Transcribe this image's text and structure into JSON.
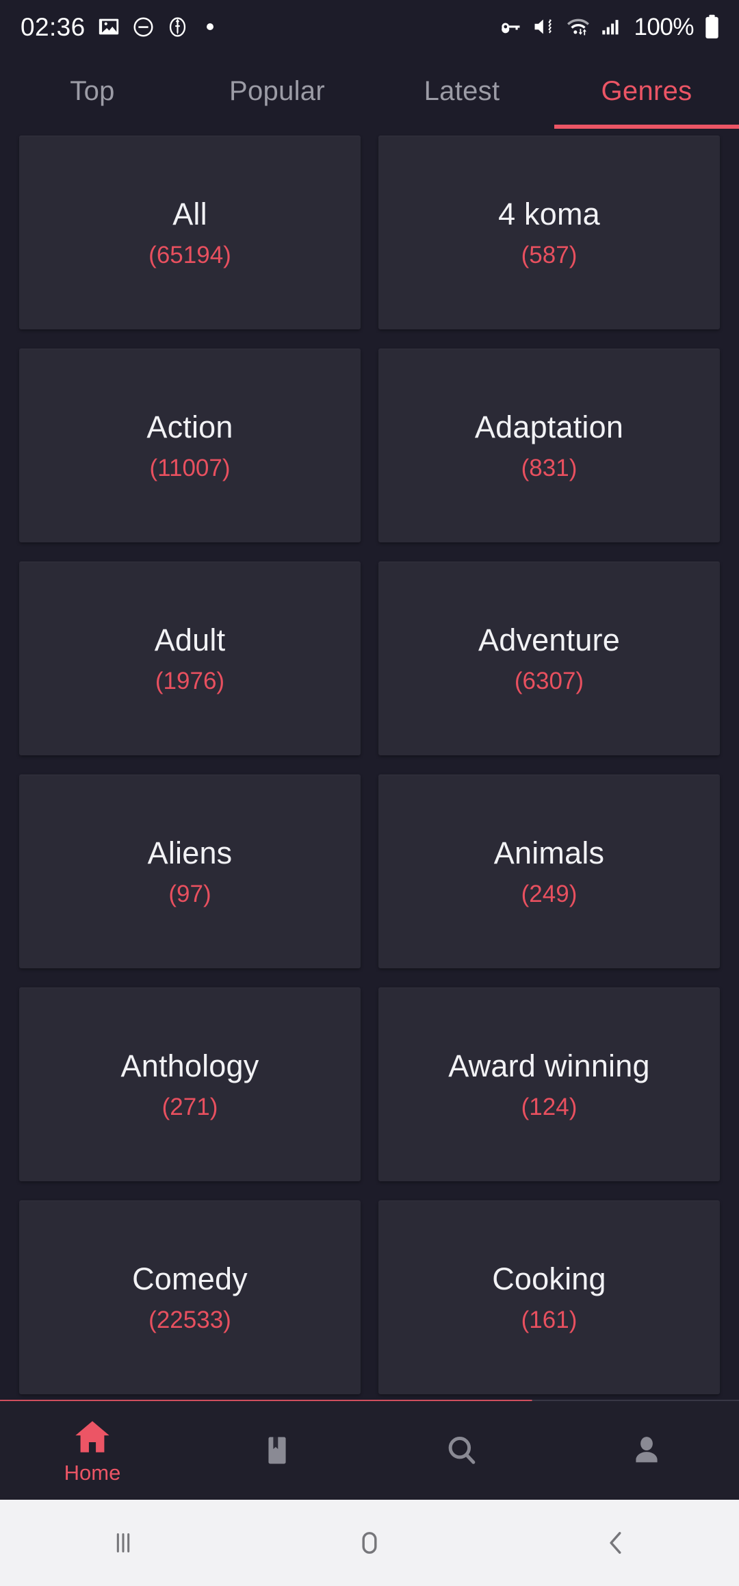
{
  "statusbar": {
    "time": "02:36",
    "battery_text": "100%",
    "left_icons": [
      "image-icon",
      "do-not-disturb-icon",
      "app-shield-icon",
      "dot-indicator"
    ],
    "right_icons": [
      "vpn-key-icon",
      "volume-mute-vibrate-icon",
      "wifi-icon",
      "cellular-signal-icon",
      "battery-icon"
    ]
  },
  "tabs": [
    {
      "label": "Top",
      "active": false
    },
    {
      "label": "Popular",
      "active": false
    },
    {
      "label": "Latest",
      "active": false
    },
    {
      "label": "Genres",
      "active": true
    }
  ],
  "genres": [
    {
      "name": "All",
      "count": "(65194)"
    },
    {
      "name": "4 koma",
      "count": "(587)"
    },
    {
      "name": "Action",
      "count": "(11007)"
    },
    {
      "name": "Adaptation",
      "count": "(831)"
    },
    {
      "name": "Adult",
      "count": "(1976)"
    },
    {
      "name": "Adventure",
      "count": "(6307)"
    },
    {
      "name": "Aliens",
      "count": "(97)"
    },
    {
      "name": "Animals",
      "count": "(249)"
    },
    {
      "name": "Anthology",
      "count": "(271)"
    },
    {
      "name": "Award winning",
      "count": "(124)"
    },
    {
      "name": "Comedy",
      "count": "(22533)"
    },
    {
      "name": "Cooking",
      "count": "(161)"
    }
  ],
  "bottomnav": [
    {
      "label": "Home",
      "icon": "home-icon",
      "active": true
    },
    {
      "label": "",
      "icon": "bookmark-icon",
      "active": false
    },
    {
      "label": "",
      "icon": "search-icon",
      "active": false
    },
    {
      "label": "",
      "icon": "person-icon",
      "active": false
    }
  ],
  "androidnav": [
    {
      "icon": "recents-icon"
    },
    {
      "icon": "home-square-icon"
    },
    {
      "icon": "back-icon"
    }
  ],
  "colors": {
    "accent": "#ec5565",
    "count_red": "#e8505f",
    "page_bg": "#1d1c29",
    "card_bg": "#2b2a36",
    "tab_inactive": "#9c9ca6",
    "nav_icon": "#8a8a94"
  }
}
